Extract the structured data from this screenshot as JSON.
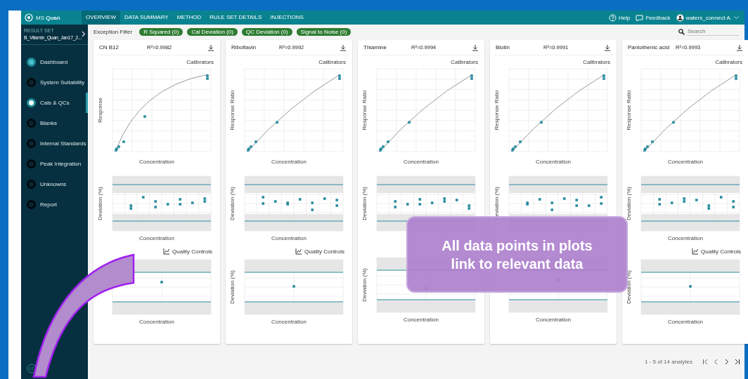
{
  "app": {
    "logo": "MS **Quan**"
  },
  "nav_tabs": [
    {
      "label": "OVERVIEW",
      "selected": true
    },
    {
      "label": "DATA SUMMARY",
      "selected": false
    },
    {
      "label": "METHOD",
      "selected": false
    },
    {
      "label": "RULE SET DETAILS",
      "selected": false
    },
    {
      "label": "INJECTIONS",
      "selected": false
    }
  ],
  "header_links": [
    {
      "label": "Help",
      "kind": "help"
    },
    {
      "label": "Feedback",
      "kind": "feedback"
    },
    {
      "label": "waters_connect A.",
      "kind": "user"
    }
  ],
  "sidebar": {
    "result_set_label": "RESULT SET",
    "result_set": "B_Vitamin_Quan_Jan17_2...",
    "items": [
      {
        "label": "Dashboard",
        "kind": "complete",
        "selected": false
      },
      {
        "label": "System Suitability",
        "kind": "pending",
        "selected": false
      },
      {
        "label": "Cals & QCs",
        "kind": "current",
        "selected": true
      },
      {
        "label": "Blanks",
        "kind": "pending",
        "selected": false
      },
      {
        "label": "Internal Standards",
        "kind": "pending",
        "selected": false
      },
      {
        "label": "Peak Integration",
        "kind": "pending",
        "selected": false
      },
      {
        "label": "Unknowns",
        "kind": "pending",
        "selected": false
      },
      {
        "label": "Report",
        "kind": "pending",
        "selected": false
      }
    ]
  },
  "filter": {
    "label": "Exception Filter",
    "chips": [
      "R Squared (0)",
      "Cal Deviation (0)",
      "QC Deviation (0)",
      "Signal to Noise (0)"
    ]
  },
  "search": {
    "placeholder": "Search"
  },
  "cards": [
    {
      "name": "CN B12",
      "r2": "R²=0.9982",
      "cal_label": "Calibrators",
      "cal_ylabel": "Response",
      "cal_xlabel": "Concentration",
      "dev_ylabel": "Deviation (%)",
      "dev_xlabel": "Concentration",
      "qc_label": "Quality Controls",
      "qc_xlabel": "Concentration"
    },
    {
      "name": "Riboflavin",
      "r2": "R²=0.9992",
      "cal_label": "Calibrators",
      "cal_ylabel": "Response Ratio",
      "cal_xlabel": "Concentration",
      "dev_ylabel": "Deviation (%)",
      "dev_xlabel": "Concentration",
      "qc_label": "Quality Controls",
      "qc_ylabel": "Deviation (%)",
      "qc_xlabel": "Concentration"
    },
    {
      "name": "Thiamine",
      "r2": "R²=0.9994",
      "cal_label": "Calibrators",
      "cal_ylabel": "Response Ratio",
      "cal_xlabel": "Concentration",
      "dev_ylabel": "Deviation (%)",
      "qc_ylabel": "Deviation (%)",
      "qc_xlabel": "Concentration"
    },
    {
      "name": "Biotin",
      "r2": "R²=0.9991",
      "cal_label": "Calibrators",
      "cal_ylabel": "Response Ratio",
      "cal_xlabel": "Concentration",
      "dev_ylabel": "Deviation (%)",
      "qc_xlabel": "Concentration"
    },
    {
      "name": "Pantothenic acid",
      "r2": "R²=0.9993",
      "cal_label": "Calibrators",
      "cal_ylabel": "Response Ratio",
      "cal_xlabel": "Concentration",
      "dev_ylabel": "Deviation (%)",
      "dev_xlabel": "Concentration",
      "qc_label": "Quality Controls",
      "qc_ylabel": "Deviation (%)",
      "qc_xlabel": "Concentration"
    }
  ],
  "pagination": {
    "summary": "1 - 5 of 14 analytes"
  },
  "callout": {
    "text": "All data points in plots link to relevant data"
  }
}
